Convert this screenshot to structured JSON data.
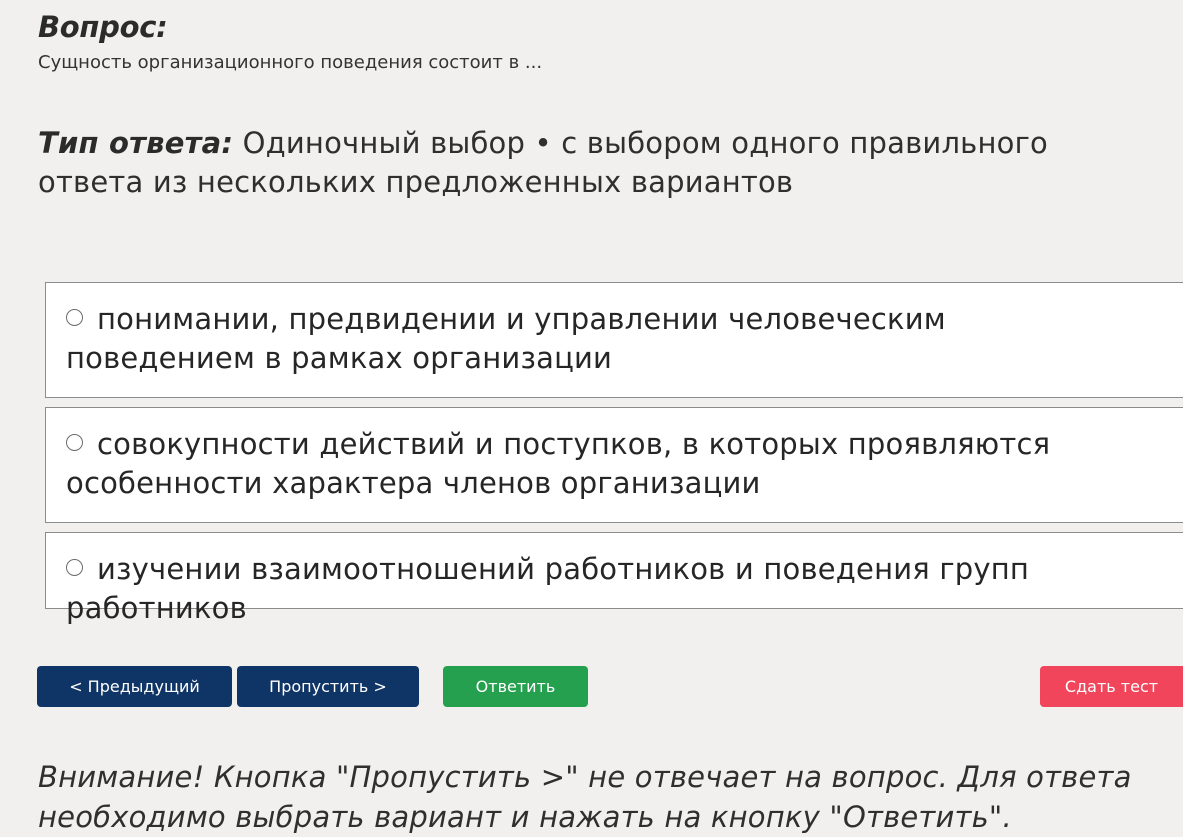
{
  "question": {
    "heading": "Вопрос:",
    "text": "Сущность организационного поведения состоит в ..."
  },
  "answer_type": {
    "label": "Тип ответа:",
    "value": "Одиночный выбор • с выбором одного правильного ответа из нескольких предложенных вариантов"
  },
  "options": [
    {
      "label": "понимании, предвидении и управлении человеческим поведением в рамках организации",
      "selected": false
    },
    {
      "label": "совокупности действий и поступков, в которых проявляются особенности характера членов организации",
      "selected": false
    },
    {
      "label": "изучении взаимоотношений работников и поведения групп работников",
      "selected": false
    }
  ],
  "buttons": {
    "prev": "< Предыдущий",
    "skip": "Пропустить >",
    "answer": "Ответить",
    "submit": "Сдать тест"
  },
  "warning": "Внимание! Кнопка \"Пропустить >\" не отвечает на вопрос. Для ответа необходимо выбрать вариант и нажать на кнопку \"Ответить\".",
  "colors": {
    "background": "#f1f0ee",
    "nav_button": "#0f3466",
    "answer_button": "#24a04f",
    "submit_button": "#f0455a"
  }
}
